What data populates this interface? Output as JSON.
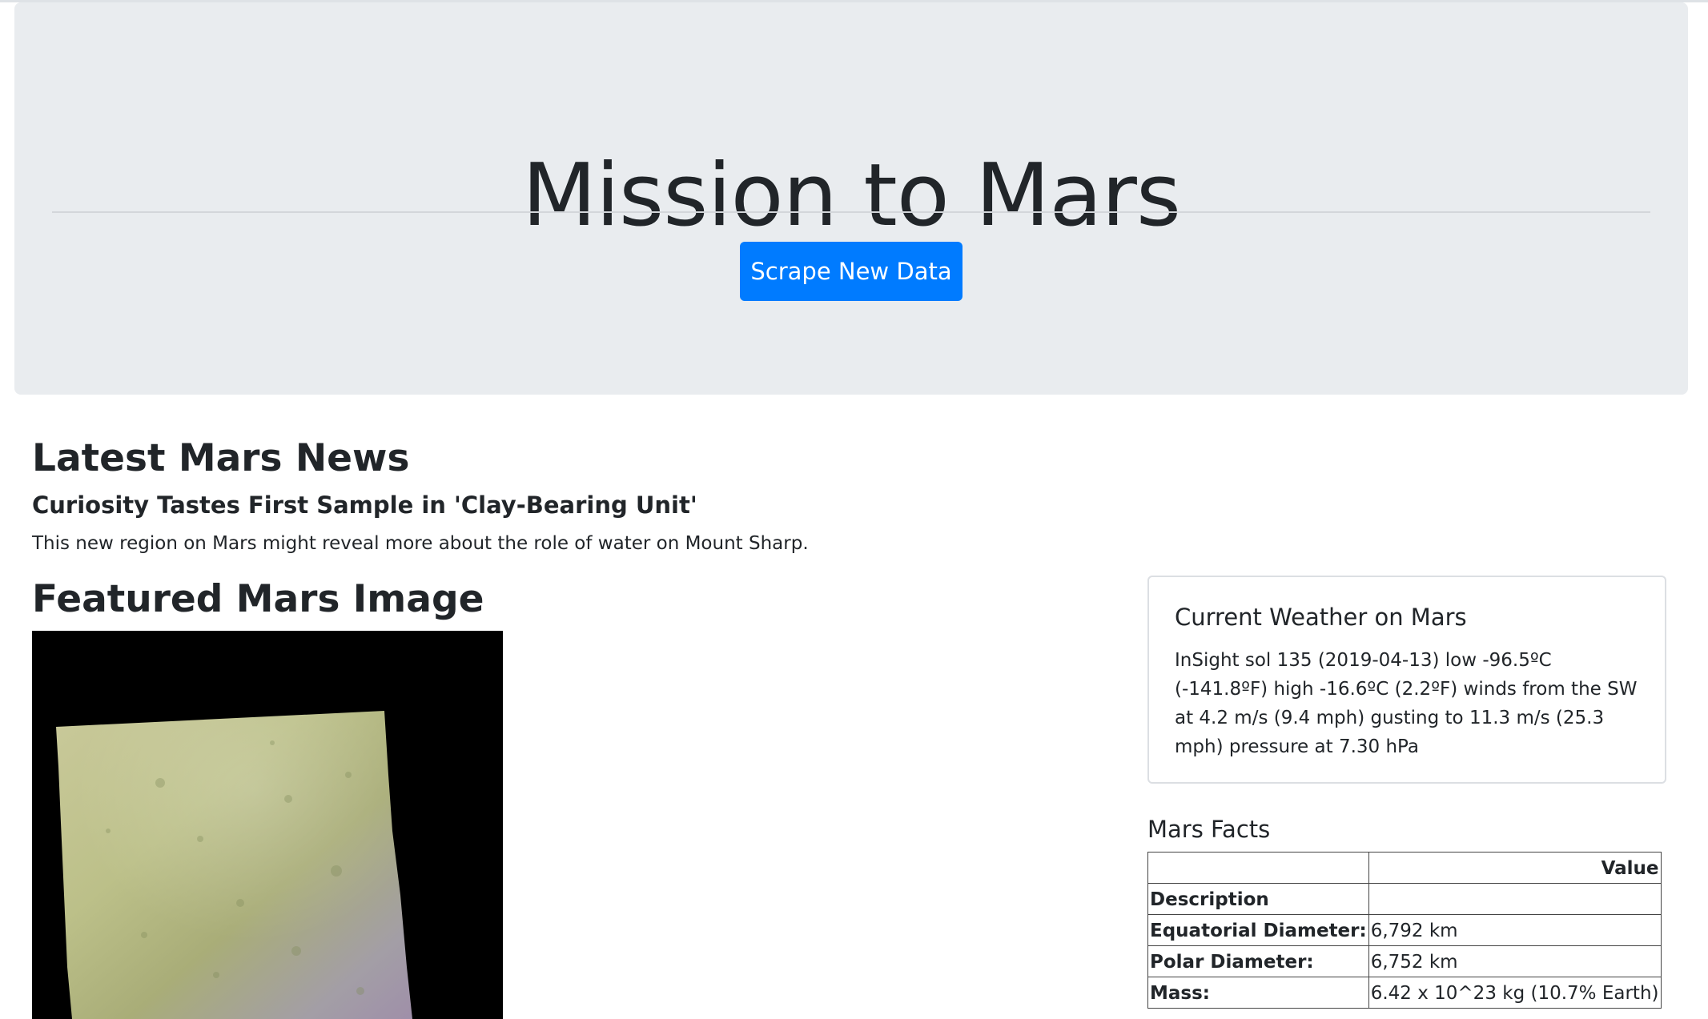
{
  "header": {
    "title": "Mission to Mars",
    "button_label": "Scrape New Data"
  },
  "news": {
    "heading": "Latest Mars News",
    "title": "Curiosity Tastes First Sample in 'Clay-Bearing Unit'",
    "paragraph": "This new region on Mars might reveal more about the role of water on Mount Sharp."
  },
  "featured": {
    "heading": "Featured Mars Image"
  },
  "weather": {
    "title": "Current Weather on Mars",
    "text": "InSight sol 135 (2019-04-13) low -96.5ºC (-141.8ºF) high -16.6ºC (2.2ºF) winds from the SW at 4.2 m/s (9.4 mph) gusting to 11.3 m/s (25.3 mph) pressure at 7.30 hPa"
  },
  "facts": {
    "title": "Mars Facts",
    "value_header": "Value",
    "description_header": "Description",
    "rows": [
      {
        "label": "Equatorial Diameter:",
        "value": "6,792 km"
      },
      {
        "label": "Polar Diameter:",
        "value": "6,752 km"
      },
      {
        "label": "Mass:",
        "value": "6.42 x 10^23 kg (10.7% Earth)"
      }
    ]
  },
  "colors": {
    "primary": "#007bff",
    "jumbotron_bg": "#e9ecef",
    "text": "#212529"
  }
}
